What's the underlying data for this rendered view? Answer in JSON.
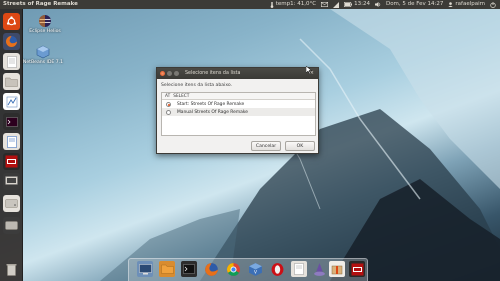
{
  "top_panel": {
    "window_title": "Streets of Rage Remake",
    "temperature": "temp1: 41,0°C",
    "time": "13:24",
    "date": "Dom, 5 de Fev 14:27",
    "user": "rafaelpaim"
  },
  "desktop": {
    "icons": [
      {
        "label": "Eclipse Helios"
      },
      {
        "label": "NetBeans IDE 7.1"
      }
    ]
  },
  "dialog": {
    "title": "Selecione itens da lista",
    "prompt": "Selecione itens da lista abaixo.",
    "columns": [
      "AT",
      "SELECT"
    ],
    "items": [
      {
        "label": "Start: Streets Of Rage Remake",
        "selected": true
      },
      {
        "label": "Manual Streets Of Rage Remake",
        "selected": false
      }
    ],
    "cancel_label": "Cancelar",
    "ok_label": "OK",
    "close_glyph": "×"
  },
  "colors": {
    "panel": "#3c3b37",
    "accent": "#dd4814"
  }
}
